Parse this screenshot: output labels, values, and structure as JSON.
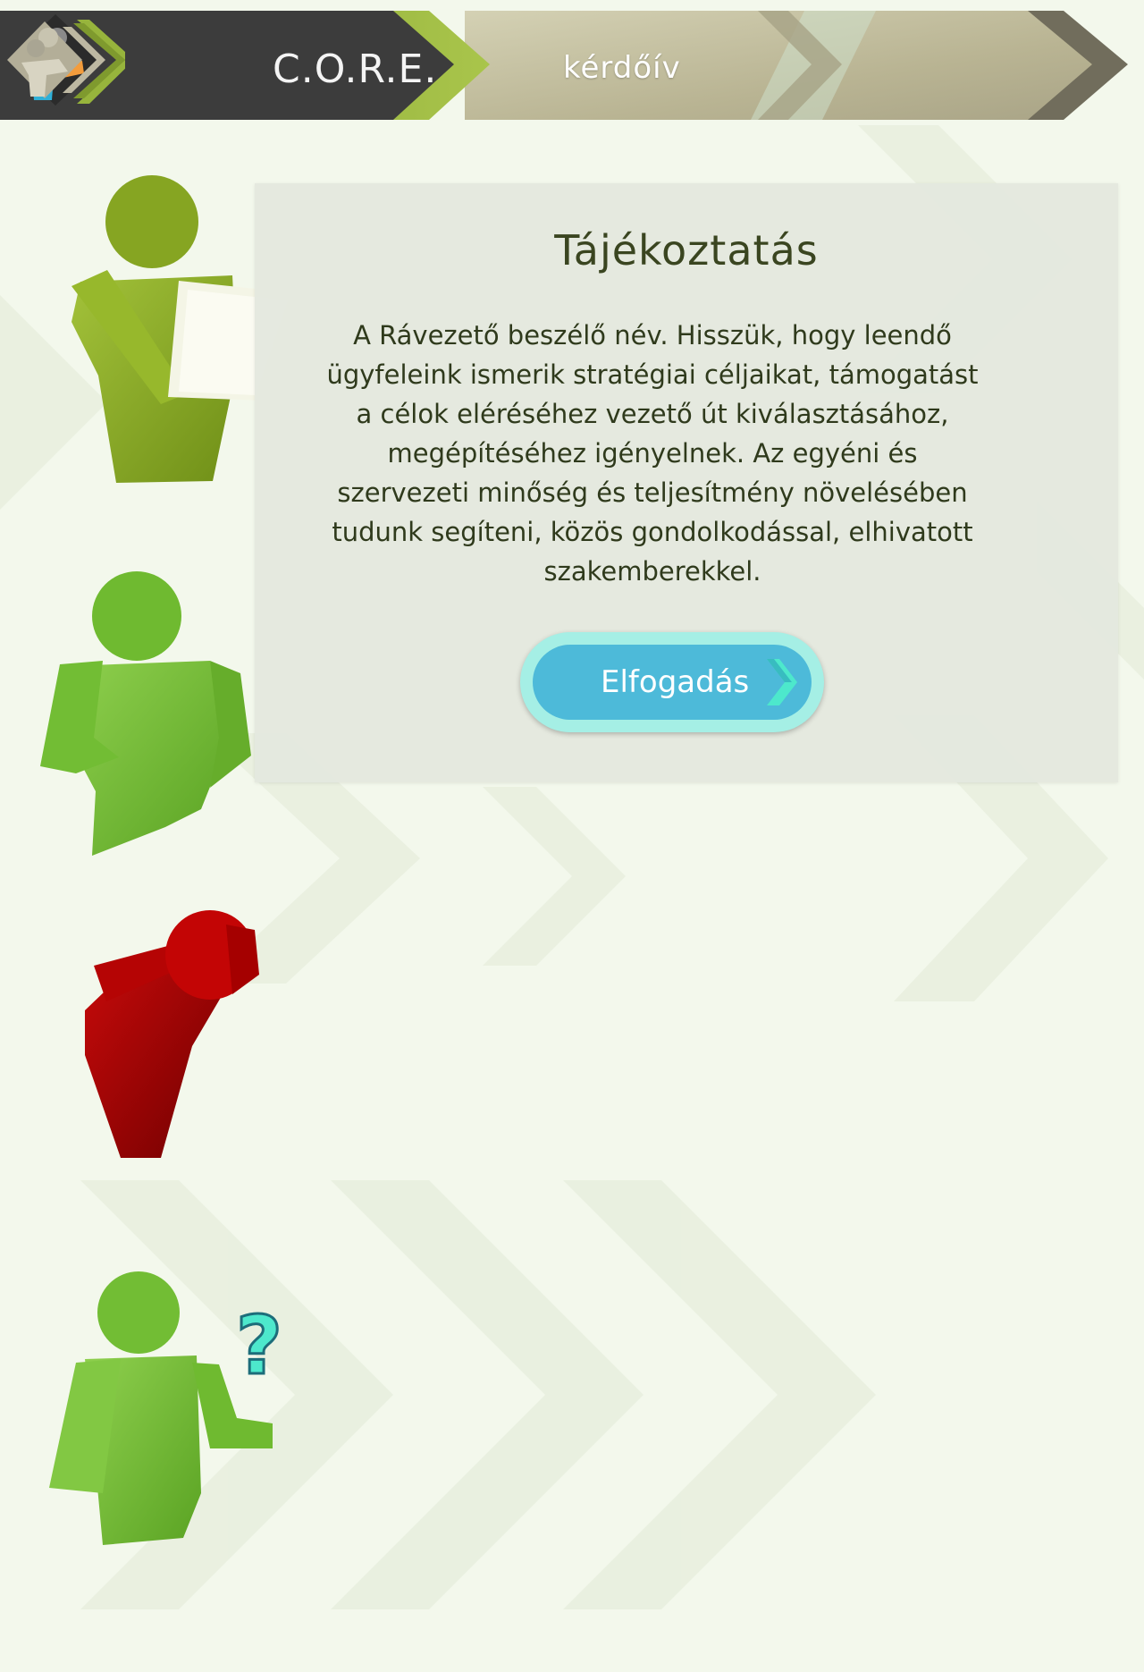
{
  "header": {
    "brand_title": "C.O.R.E.",
    "subtitle": "kérdőív",
    "logo_icon": "core-people-logo",
    "next_icon": "people-chevron-icon"
  },
  "panel": {
    "title": "Tájékoztatás",
    "body": "A Rávezető beszélő név. Hisszük, hogy leendő ügyfeleink ismerik stratégiai céljaikat, támogatást a célok eléréséhez vezető út kiválasztásához, megépítéséhez igényelnek. Az egyéni és szervezeti minőség és teljesítmény növelésében tudunk segíteni, közös gondolkodással, elhivatott szakemberekkel.",
    "accept_button": "Elfogadás"
  },
  "figures": [
    {
      "name": "person-reading-icon",
      "color": "#8fb02a"
    },
    {
      "name": "person-standing-icon",
      "color": "#7cc23c"
    },
    {
      "name": "person-confused-icon",
      "color": "#b80000"
    },
    {
      "name": "person-question-icon",
      "color": "#7cc23c"
    }
  ],
  "colors": {
    "header_dark": "#3d3d3d",
    "header_green": "#97b43c",
    "header_tan": "#c9c5a5",
    "button": "#4dbad9",
    "button_glow": "#a5efe5",
    "accent_cyan": "#4de8cc"
  }
}
